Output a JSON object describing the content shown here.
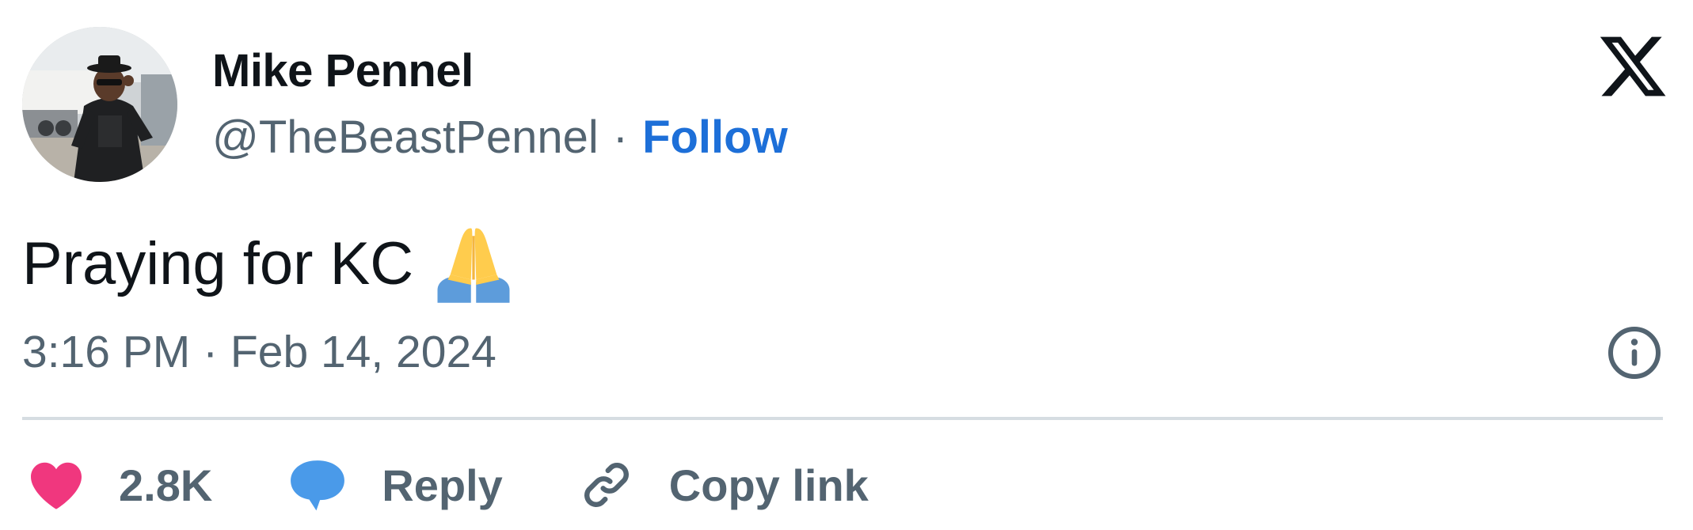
{
  "author": {
    "display_name": "Mike Pennel",
    "handle": "@TheBeastPennel",
    "separator": "·",
    "follow_label": "Follow"
  },
  "tweet": {
    "text": "Praying for KC",
    "emoji": "folded-hands",
    "timestamp": "3:16 PM · Feb 14, 2024"
  },
  "actions": {
    "like_count": "2.8K",
    "reply_label": "Reply",
    "copy_link_label": "Copy link"
  },
  "colors": {
    "link_blue": "#1d6fd8",
    "secondary_text": "#536471",
    "heart": "#f0377e",
    "reply_bubble": "#4a9ae9",
    "divider": "#d6dde2"
  },
  "icons": [
    "x-logo-icon",
    "info-icon",
    "heart-icon",
    "speech-bubble-icon",
    "link-icon"
  ]
}
